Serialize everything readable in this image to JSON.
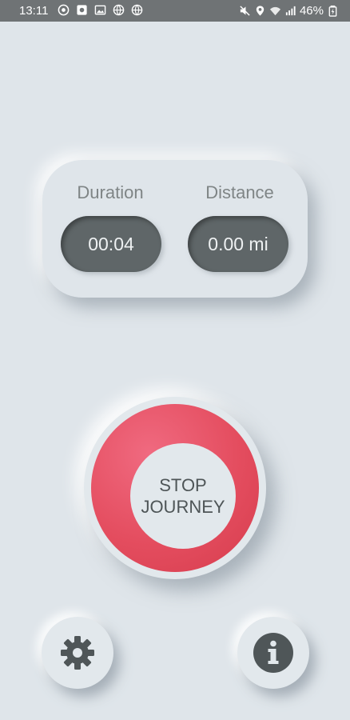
{
  "status_bar": {
    "time": "13:11",
    "battery": "46%",
    "icons": [
      "whatsapp-icon",
      "notification-box-icon",
      "gallery-icon",
      "globe-icon",
      "globe-icon",
      "mute-icon",
      "location-icon",
      "wifi-icon",
      "signal-icon",
      "battery-icon"
    ]
  },
  "stats": {
    "duration_label": "Duration",
    "duration_value": "00:04",
    "distance_label": "Distance",
    "distance_value": "0.00 mi"
  },
  "stop_button": {
    "line1": "STOP",
    "line2": "JOURNEY"
  },
  "bottom_buttons": {
    "settings_icon": "gear-icon",
    "info_icon": "info-icon"
  },
  "colors": {
    "background": "#dfe5ea",
    "pill": "#5f6668",
    "stop_ring": "#e44d5f",
    "icon": "#4f5658"
  }
}
